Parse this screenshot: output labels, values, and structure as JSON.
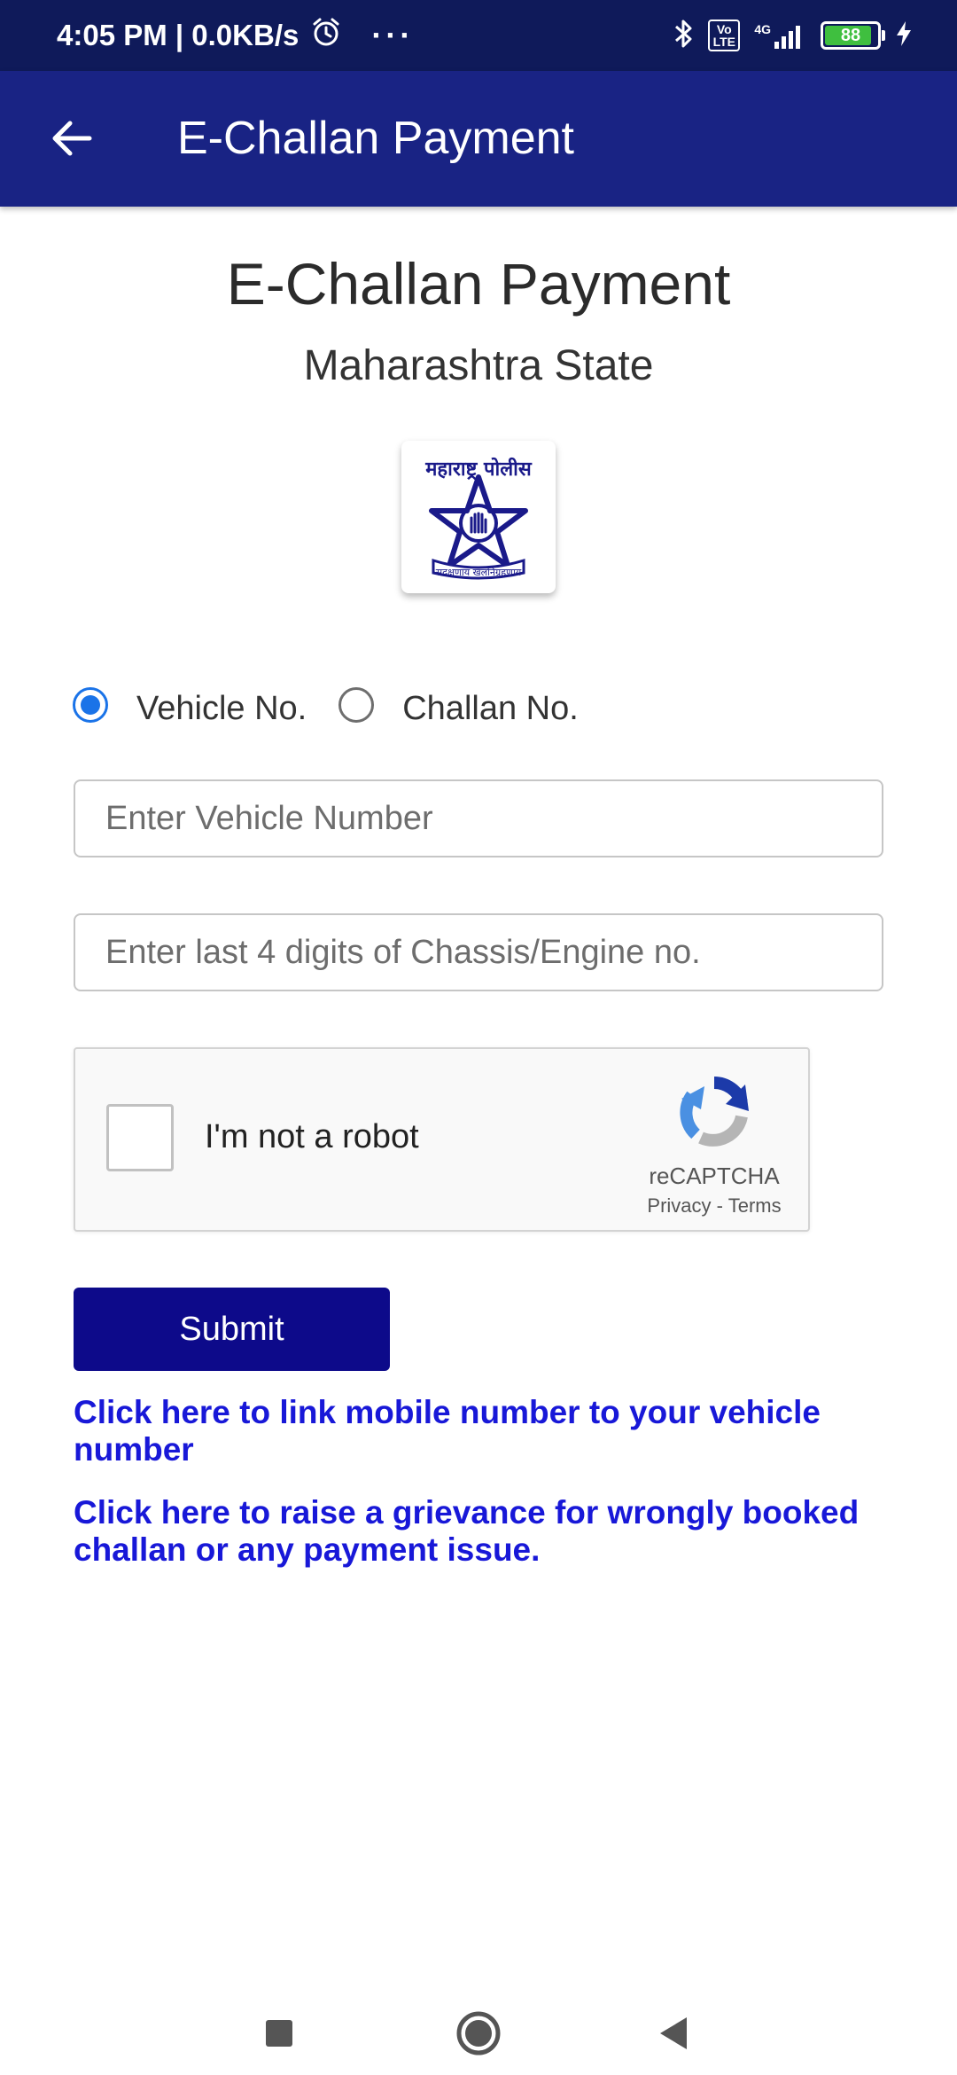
{
  "status_bar": {
    "time_speed": "4:05 PM | 0.0KB/s",
    "overflow": "···",
    "network": "4G",
    "volte": "Vo LTE",
    "battery": "88"
  },
  "app_bar": {
    "title": "E-Challan Payment"
  },
  "content": {
    "heading": "E-Challan Payment",
    "subheading": "Maharashtra State",
    "logo": {
      "top_text": "महाराष्ट्र पोलीस",
      "motto": "सद्रक्षणाय खलनिग्रहणाय"
    },
    "search_by": {
      "options": [
        {
          "label": "Vehicle No.",
          "selected": true
        },
        {
          "label": "Challan No.",
          "selected": false
        }
      ]
    },
    "vehicle_input": {
      "placeholder": "Enter Vehicle Number",
      "value": ""
    },
    "chassis_input": {
      "placeholder": "Enter last 4 digits of Chassis/Engine no.",
      "value": ""
    },
    "recaptcha": {
      "label": "I'm not a robot",
      "brand": "reCAPTCHA",
      "privacy": "Privacy",
      "separator": "-",
      "terms": "Terms"
    },
    "submit_label": "Submit",
    "links": {
      "mobile_link": "Click here to link mobile number to your vehicle number",
      "grievance_link": "Click here to raise a grievance for wrongly booked challan or any payment issue."
    }
  },
  "colors": {
    "status_bar": "#0f1a5a",
    "app_bar": "#192384",
    "submit": "#0d0a8a",
    "link": "#1818d8",
    "radio_accent": "#1a73e8"
  }
}
